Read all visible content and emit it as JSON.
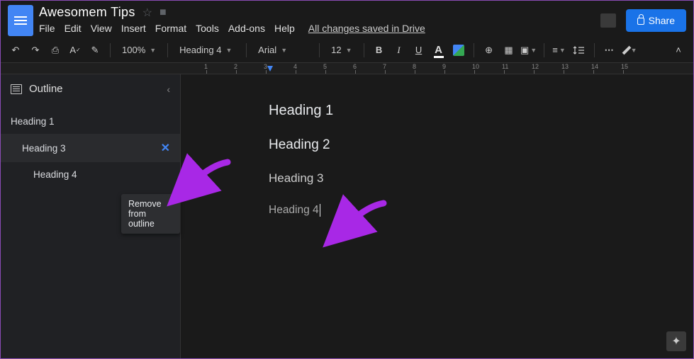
{
  "doc": {
    "title": "Awesomem Tips",
    "save_status": "All changes saved in Drive"
  },
  "menus": {
    "file": "File",
    "edit": "Edit",
    "view": "View",
    "insert": "Insert",
    "format": "Format",
    "tools": "Tools",
    "addons": "Add-ons",
    "help": "Help"
  },
  "share": {
    "label": "Share"
  },
  "toolbar": {
    "zoom": "100%",
    "style": "Heading 4",
    "font": "Arial",
    "font_size": "12"
  },
  "outline": {
    "title": "Outline",
    "items": [
      {
        "label": "Heading 1",
        "indent": 0,
        "hover": false
      },
      {
        "label": "Heading 3",
        "indent": 1,
        "hover": true
      },
      {
        "label": "Heading 4",
        "indent": 2,
        "hover": false
      }
    ]
  },
  "tooltip": {
    "label": "Remove from outline"
  },
  "document": {
    "h1": "Heading 1",
    "h2": "Heading 2",
    "h3": "Heading 3",
    "h4": "Heading 4"
  },
  "ruler": {
    "ticks": [
      "1",
      "2",
      "3",
      "4",
      "5",
      "6",
      "7",
      "8",
      "9",
      "10",
      "11",
      "12",
      "13",
      "14",
      "15"
    ]
  },
  "colors": {
    "accent": "#4285f4",
    "share": "#1a73e8",
    "arrow": "#a828e6"
  }
}
